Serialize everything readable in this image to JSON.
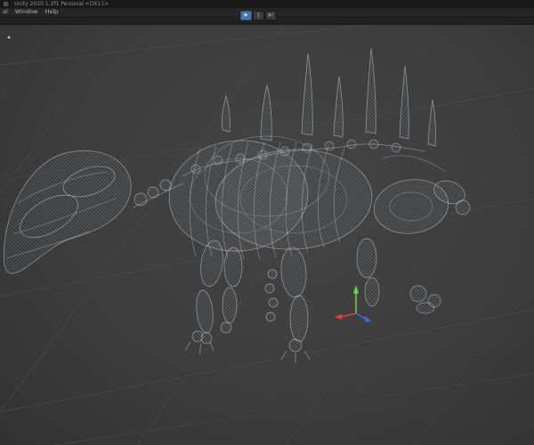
{
  "titlebar": {
    "title": "Unity 2020.1.2f1 Personal <DX11>"
  },
  "menubar": {
    "items": [
      {
        "label": "al"
      },
      {
        "label": "Window"
      },
      {
        "label": "Help"
      }
    ]
  },
  "toolbar": {
    "buttons": [
      {
        "name": "play",
        "glyph": "▶",
        "active": true
      },
      {
        "name": "pause",
        "glyph": "‖",
        "active": false
      },
      {
        "name": "step",
        "glyph": "▶|",
        "active": false
      }
    ]
  },
  "scene": {
    "description": "3D scene view showing wireframe skeleton mesh of a quadruped dinosaur",
    "background_color": "#3d3d3d",
    "grid_color": "#474747",
    "wireframe_color": "#c8d6e4",
    "gizmo": {
      "x_axis_color": "#e04337",
      "y_axis_color": "#6ad53a",
      "z_axis_color": "#3a66e0"
    }
  }
}
